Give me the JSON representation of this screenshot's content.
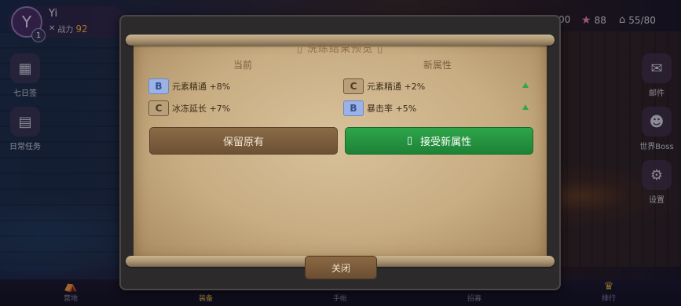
{
  "player": {
    "avatar_letter": "Y",
    "level": "1",
    "name": "Yi",
    "power_label": "战力",
    "power_value": "92"
  },
  "resources": {
    "gold": "00",
    "stars": "88",
    "stamina": "55/80"
  },
  "side_left": [
    {
      "label": "七日签"
    },
    {
      "label": "日常任务"
    }
  ],
  "side_right": [
    {
      "label": "邮件"
    },
    {
      "label": "世界Boss"
    },
    {
      "label": "设置"
    }
  ],
  "bottom_nav": [
    {
      "label": "营地"
    },
    {
      "label": "装备"
    },
    {
      "label": "手帐"
    },
    {
      "label": "招募"
    },
    {
      "label": "排行"
    }
  ],
  "modal": {
    "title": "洗练结果预览",
    "col_current": "当前",
    "col_new": "新属性",
    "current": [
      {
        "grade": "B",
        "text": "元素精通 +8%"
      },
      {
        "grade": "C",
        "text": "冰冻延长 +7%"
      }
    ],
    "new": [
      {
        "grade": "C",
        "text": "元素精通 +2%"
      },
      {
        "grade": "B",
        "text": "暴击率 +5%"
      }
    ],
    "keep_label": "保留原有",
    "accept_label": "接受新属性",
    "close_label": "关闭"
  },
  "colors": {
    "accent_green": "#1d8236",
    "grade_b": "#9bb2e6",
    "grade_c": "#b9a07a",
    "power_gold": "#f2b64a"
  }
}
